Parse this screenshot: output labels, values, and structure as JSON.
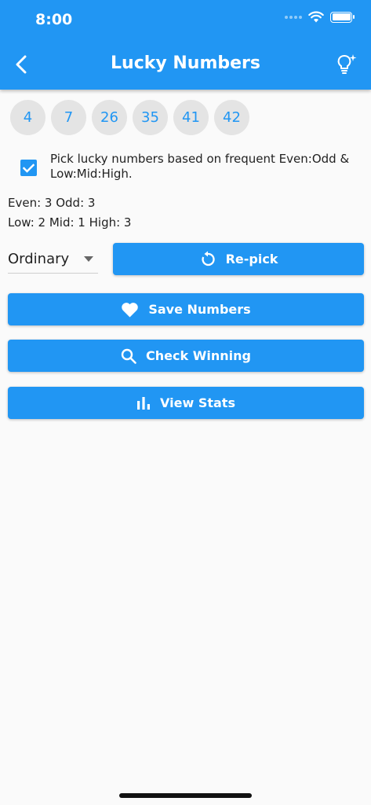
{
  "status_bar": {
    "time": "8:00"
  },
  "app_bar": {
    "title": "Lucky Numbers"
  },
  "numbers": [
    "4",
    "7",
    "26",
    "35",
    "41",
    "42"
  ],
  "pick_option": {
    "checked": true,
    "label": "Pick lucky numbers based on frequent Even:Odd & Low:Mid:High."
  },
  "stats": {
    "even_odd": "Even: 3 Odd: 3",
    "low_mid_high": "Low: 2 Mid: 1 High: 3"
  },
  "game_type": {
    "selected": "Ordinary"
  },
  "buttons": {
    "repick": "Re-pick",
    "save": "Save Numbers",
    "check": "Check Winning",
    "stats": "View Stats"
  },
  "colors": {
    "primary": "#2196f3",
    "background": "#fafafa",
    "ball": "#e4e4e4"
  },
  "icons": [
    "back-arrow-icon",
    "lightbulb-icon",
    "wifi-icon",
    "battery-icon",
    "checkbox-icon",
    "dropdown-arrow-icon",
    "replay-icon",
    "heart-icon",
    "search-icon",
    "bar-chart-icon"
  ]
}
